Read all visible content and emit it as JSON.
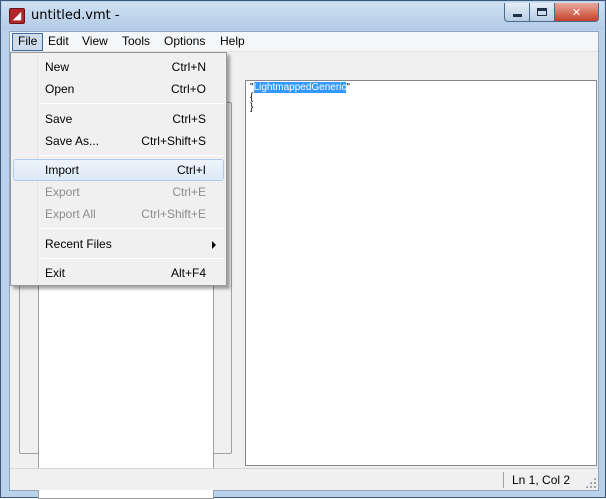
{
  "window": {
    "title": "untitled.vmt -",
    "icon": "app-icon",
    "icon_glyph": "◢",
    "controls": {
      "minimize": "minimize-icon",
      "maximize": "maximize-icon",
      "close": "✕"
    }
  },
  "menubar": {
    "items": [
      "File",
      "Edit",
      "View",
      "Tools",
      "Options",
      "Help"
    ]
  },
  "file_menu": {
    "items": [
      {
        "label": "New",
        "shortcut": "Ctrl+N",
        "enabled": true
      },
      {
        "label": "Open",
        "shortcut": "Ctrl+O",
        "enabled": true
      },
      {
        "label": "Save",
        "shortcut": "Ctrl+S",
        "enabled": true
      },
      {
        "label": "Save As...",
        "shortcut": "Ctrl+Shift+S",
        "enabled": true
      },
      {
        "label": "Import",
        "shortcut": "Ctrl+I",
        "enabled": true,
        "highlighted": true
      },
      {
        "label": "Export",
        "shortcut": "Ctrl+E",
        "enabled": false
      },
      {
        "label": "Export All",
        "shortcut": "Ctrl+Shift+E",
        "enabled": false
      },
      {
        "label": "Recent Files",
        "shortcut": "",
        "enabled": true,
        "submenu": true
      },
      {
        "label": "Exit",
        "shortcut": "Alt+F4",
        "enabled": true
      }
    ]
  },
  "editor": {
    "lines": {
      "l1_open_quote": "\"",
      "l1_selected": "LightmappedGeneric",
      "l1_close_quote": "\"",
      "l2": "{",
      "l3": "}"
    }
  },
  "statusbar": {
    "position": "Ln 1, Col 2"
  },
  "colors": {
    "selection": "#3399ff",
    "menu_highlight": "#dce9f7",
    "close_button": "#c4412a"
  }
}
